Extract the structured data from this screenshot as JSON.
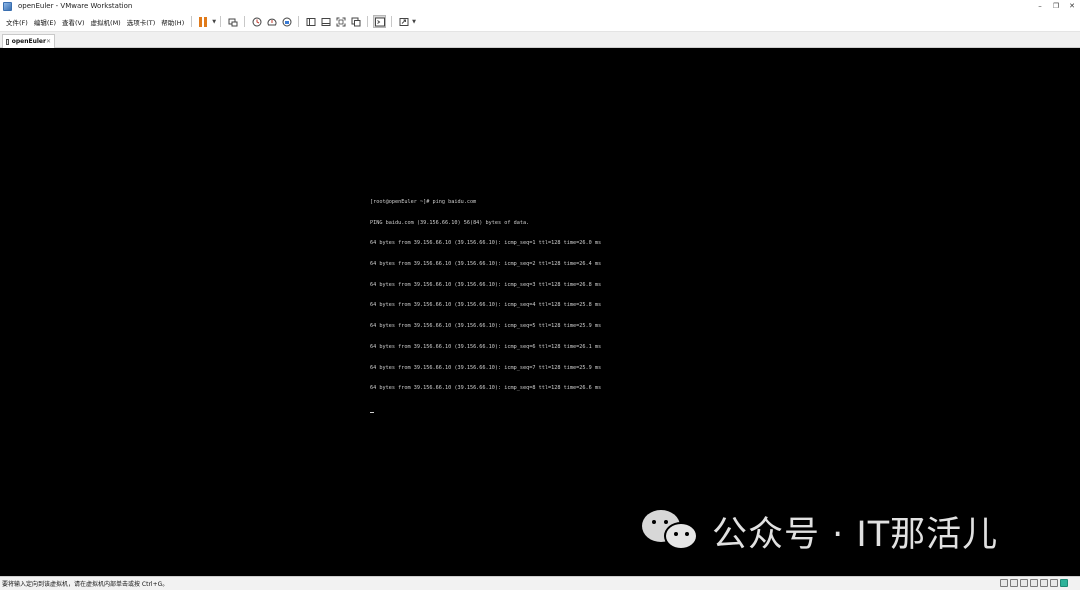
{
  "window": {
    "title": "openEuler - VMware Workstation",
    "minimize_glyph": "–",
    "restore_glyph": "❐",
    "close_glyph": "✕"
  },
  "menu": {
    "items": [
      "文件(F)",
      "编辑(E)",
      "查看(V)",
      "虚拟机(M)",
      "选项卡(T)",
      "帮助(H)"
    ]
  },
  "toolbar": {
    "icons": [
      "pause-icon",
      "send-keys-icon",
      "snapshot-icon",
      "revert-snapshot-icon",
      "snapshot-manager-icon",
      "sidebar-icon",
      "thumbnail-icon",
      "full-screen-icon",
      "unity-icon",
      "console-view-icon",
      "stretch-icon"
    ]
  },
  "tab": {
    "label": "openEuler",
    "close_glyph": "✕"
  },
  "terminal": {
    "lines": [
      "[root@openEuler ~]# ping baidu.com",
      "PING baidu.com (39.156.66.10) 56(84) bytes of data.",
      "64 bytes from 39.156.66.10 (39.156.66.10): icmp_seq=1 ttl=128 time=26.0 ms",
      "64 bytes from 39.156.66.10 (39.156.66.10): icmp_seq=2 ttl=128 time=26.4 ms",
      "64 bytes from 39.156.66.10 (39.156.66.10): icmp_seq=3 ttl=128 time=26.8 ms",
      "64 bytes from 39.156.66.10 (39.156.66.10): icmp_seq=4 ttl=128 time=25.8 ms",
      "64 bytes from 39.156.66.10 (39.156.66.10): icmp_seq=5 ttl=128 time=25.9 ms",
      "64 bytes from 39.156.66.10 (39.156.66.10): icmp_seq=6 ttl=128 time=26.1 ms",
      "64 bytes from 39.156.66.10 (39.156.66.10): icmp_seq=7 ttl=128 time=25.9 ms",
      "64 bytes from 39.156.66.10 (39.156.66.10): icmp_seq=8 ttl=128 time=26.6 ms"
    ]
  },
  "watermark": {
    "text": "公众号 · IT那活儿"
  },
  "statusbar": {
    "text": "要将输入定向到该虚拟机，请在虚拟机内部单击或按 Ctrl+G。"
  },
  "colors": {
    "pause_accent": "#e07a1a",
    "terminal_bg": "#000000",
    "terminal_fg": "#cfcfcf"
  }
}
